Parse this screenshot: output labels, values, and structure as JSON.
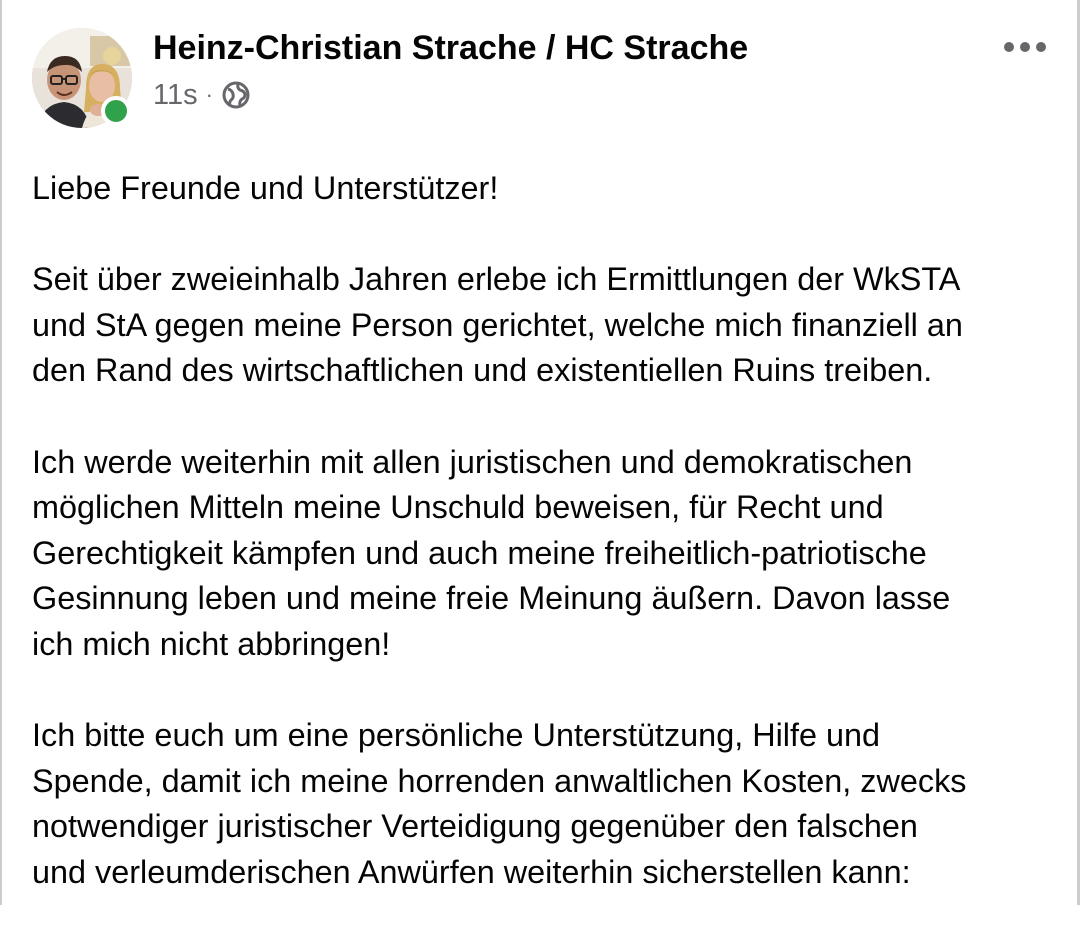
{
  "author": {
    "name": "Heinz-Christian Strache / HC Strache",
    "status": "online",
    "status_color": "#31a24c"
  },
  "meta": {
    "timestamp": "11s",
    "separator": "·",
    "audience_icon": "globe-icon"
  },
  "actions": {
    "more_icon": "more-options-icon"
  },
  "post": {
    "paragraphs": [
      "Liebe Freunde und Unterstützer!",
      "Seit über zweieinhalb Jahren erlebe ich Ermittlungen der WkSTA\nund StA gegen meine Person gerichtet, welche mich finanziell an\nden Rand des wirtschaftlichen und existentiellen Ruins treiben.",
      "Ich werde weiterhin mit allen juristischen und demokratischen\nmöglichen Mitteln meine Unschuld beweisen, für Recht und\nGerechtigkeit kämpfen und auch meine freiheitlich-patriotische\nGesinnung leben und meine freie Meinung äußern. Davon lasse\nich mich nicht abbringen!",
      "Ich bitte euch um eine persönliche Unterstützung, Hilfe und\nSpende, damit ich meine horrenden anwaltlichen Kosten, zwecks\nnotwendiger juristischer Verteidigung gegenüber den falschen\nund verleumderischen Anwürfen weiterhin sicherstellen kann:"
    ]
  },
  "colors": {
    "text_primary": "#050505",
    "text_secondary": "#65676b",
    "background": "#ffffff"
  }
}
